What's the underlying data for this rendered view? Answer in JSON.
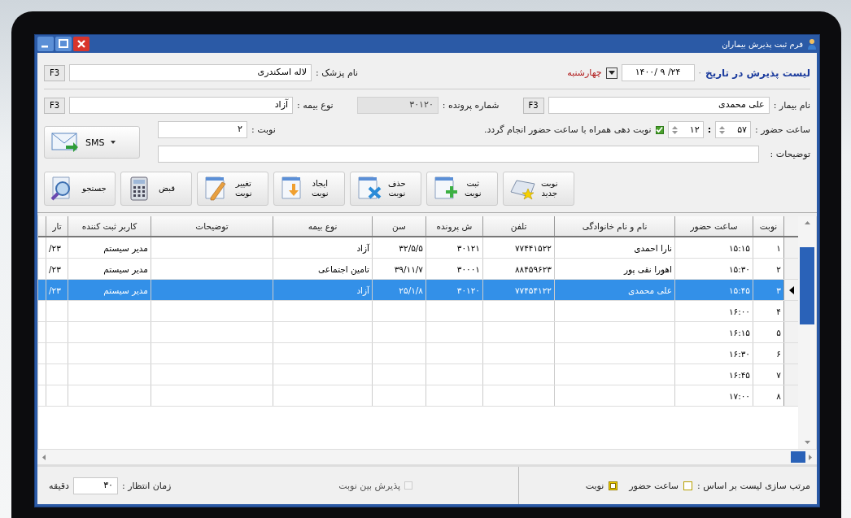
{
  "window": {
    "title": "فرم ثبت پذیرش بیماران"
  },
  "header": {
    "title": "لیست پذیرش در تاریخ",
    "separator": "·",
    "date": "۱۴۰۰/ ۹ /۲۴",
    "weekday": "چهارشنبه",
    "doctor": {
      "label": "نام پزشک :",
      "value": "لاله اسکندری",
      "key": "F3"
    },
    "patient": {
      "label": "نام بیمار :",
      "value": "علی محمدی",
      "key": "F3"
    },
    "file_number": {
      "label": "شماره پرونده :",
      "value": "۳۰۱۲۰",
      "disabled": true
    },
    "insurance": {
      "label": "نوع بیمه :",
      "value": "آزاد",
      "key": "F3"
    },
    "arrival": {
      "label": "ساعت حضور :",
      "minute": "۵۷",
      "separator": ":",
      "hour": "۱۲"
    },
    "sync": {
      "label": "نوبت دهی همراه با ساعت حضور انجام گردد.",
      "checked": true
    },
    "turn": {
      "label": "نوبت :",
      "value": "۲"
    },
    "notes": {
      "label": "توضیحات :"
    },
    "sms": {
      "label": "SMS"
    }
  },
  "toolbar": [
    {
      "label": "نوبت\nجدید",
      "kind": "new"
    },
    {
      "label": "ثبت\nنوبت",
      "kind": "save"
    },
    {
      "label": "حذف\nنوبت",
      "kind": "delete"
    },
    {
      "label": "ایجاد\nنوبت",
      "kind": "create"
    },
    {
      "label": "تغییر\nنوبت",
      "kind": "edit"
    },
    {
      "label": "قبض",
      "kind": "receipt"
    },
    {
      "label": "جستجو",
      "kind": "search"
    }
  ],
  "table": {
    "columns": [
      "نوبت",
      "ساعت حضور",
      "نام و نام خانوادگی",
      "تلفن",
      "ش پرونده",
      "سن",
      "نوع بیمه",
      "توضیحات",
      "کاربر ثبت کننده",
      "تار"
    ],
    "rows": [
      {
        "turn": "۱",
        "time": "۱۵:۱۵",
        "name": "نارا احمدی",
        "phone": "۷۷۴۴۱۵۲۲",
        "file": "۳۰۱۲۱",
        "age": "۳۲/۵/۵",
        "insurance": "آزاد",
        "user": "مدیر سیستم",
        "column_10": "/۲۳",
        "selected": false
      },
      {
        "turn": "۲",
        "time": "۱۵:۳۰",
        "name": "اهورا نقی پور",
        "phone": "۸۸۴۵۹۶۲۳",
        "file": "۳۰۰۰۱",
        "age": "۳۹/۱۱/۷",
        "insurance": "تامین اجتماعی",
        "user": "مدیر سیستم",
        "column_10": "/۲۳",
        "selected": false
      },
      {
        "turn": "۳",
        "time": "۱۵:۴۵",
        "name": "علی محمدی",
        "phone": "۷۷۴۵۴۱۲۲",
        "file": "۳۰۱۲۰",
        "age": "۲۵/۱/۸",
        "insurance": "آزاد",
        "user": "مدیر سیستم",
        "column_10": "/۲۳",
        "selected": true
      },
      {
        "turn": "۴",
        "time": "۱۶:۰۰",
        "selected": false
      },
      {
        "turn": "۵",
        "time": "۱۶:۱۵",
        "selected": false
      },
      {
        "turn": "۶",
        "time": "۱۶:۳۰",
        "selected": false
      },
      {
        "turn": "۷",
        "time": "۱۶:۴۵",
        "selected": false
      },
      {
        "turn": "۸",
        "time": "۱۷:۰۰",
        "selected": false
      }
    ]
  },
  "footer": {
    "sort_label": "مرتب سازی لیست بر اساس :",
    "sort_options": [
      {
        "label": "ساعت حضور",
        "selected": false
      },
      {
        "label": "نوبت",
        "selected": true
      }
    ],
    "between": {
      "label": "پذیرش بین نوبت",
      "checked": false,
      "disabled": true
    },
    "wait": {
      "label": "زمان انتظار :",
      "value": "۳۰",
      "unit": "دقیقه"
    }
  }
}
